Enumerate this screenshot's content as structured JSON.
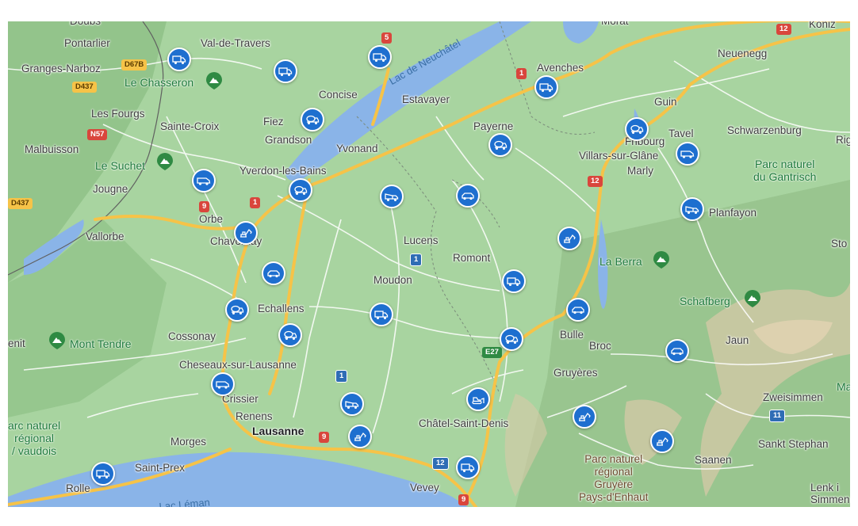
{
  "map": {
    "places": [
      {
        "id": "doubs",
        "text": "Doubs",
        "cls": "town"
      },
      {
        "id": "pontarlier",
        "text": "Pontarlier",
        "cls": "town"
      },
      {
        "id": "val-de-travers",
        "text": "Val-de-Travers",
        "cls": "town"
      },
      {
        "id": "morat",
        "text": "Morat",
        "cls": "town"
      },
      {
        "id": "koniz",
        "text": "Köniz",
        "cls": "town"
      },
      {
        "id": "granges-narboz",
        "text": "Granges-Narboz",
        "cls": "town"
      },
      {
        "id": "le-chasseron",
        "text": "Le Chasseron",
        "cls": "park"
      },
      {
        "id": "neuenegg",
        "text": "Neuenegg",
        "cls": "town"
      },
      {
        "id": "avenches",
        "text": "Avenches",
        "cls": "town"
      },
      {
        "id": "concise",
        "text": "Concise",
        "cls": "town"
      },
      {
        "id": "estavayer",
        "text": "Estavayer",
        "cls": "town"
      },
      {
        "id": "guin",
        "text": "Guin",
        "cls": "town"
      },
      {
        "id": "les-fourgs",
        "text": "Les Fourgs",
        "cls": "town"
      },
      {
        "id": "sainte-croix",
        "text": "Sainte-Croix",
        "cls": "town"
      },
      {
        "id": "fiez",
        "text": "Fiez",
        "cls": "town"
      },
      {
        "id": "payerne",
        "text": "Payerne",
        "cls": "town"
      },
      {
        "id": "schwarzenburg",
        "text": "Schwarzenburg",
        "cls": "town"
      },
      {
        "id": "tavel",
        "text": "Tavel",
        "cls": "town"
      },
      {
        "id": "fribourg",
        "text": "Fribourg",
        "cls": "town"
      },
      {
        "id": "rig",
        "text": "Rig",
        "cls": "town"
      },
      {
        "id": "grandson",
        "text": "Grandson",
        "cls": "town"
      },
      {
        "id": "malbuisson",
        "text": "Malbuisson",
        "cls": "town"
      },
      {
        "id": "yvonand",
        "text": "Yvonand",
        "cls": "town"
      },
      {
        "id": "villars-sur-glane",
        "text": "Villars-sur-Glâne",
        "cls": "town"
      },
      {
        "id": "le-suchet",
        "text": "Le Suchet",
        "cls": "park"
      },
      {
        "id": "marly",
        "text": "Marly",
        "cls": "town"
      },
      {
        "id": "parc-gantrisch",
        "text": "Parc naturel\ndu Gantrisch",
        "cls": "park"
      },
      {
        "id": "yverdon",
        "text": "Yverdon-les-Bains",
        "cls": "town"
      },
      {
        "id": "jougne",
        "text": "Jougne",
        "cls": "town"
      },
      {
        "id": "planfayon",
        "text": "Planfayon",
        "cls": "town"
      },
      {
        "id": "orbe",
        "text": "Orbe",
        "cls": "town"
      },
      {
        "id": "vallorbe",
        "text": "Vallorbe",
        "cls": "town"
      },
      {
        "id": "chavornay",
        "text": "Chavornay",
        "cls": "town"
      },
      {
        "id": "lucens",
        "text": "Lucens",
        "cls": "town"
      },
      {
        "id": "sto",
        "text": "Sto",
        "cls": "town"
      },
      {
        "id": "romont",
        "text": "Romont",
        "cls": "town"
      },
      {
        "id": "la-berra",
        "text": "La Berra",
        "cls": "park"
      },
      {
        "id": "moudon",
        "text": "Moudon",
        "cls": "town"
      },
      {
        "id": "schafberg",
        "text": "Schafberg",
        "cls": "park"
      },
      {
        "id": "echallens",
        "text": "Echallens",
        "cls": "town"
      },
      {
        "id": "mont-tendre",
        "text": "Mont Tendre",
        "cls": "park"
      },
      {
        "id": "enit",
        "text": "enit",
        "cls": "town"
      },
      {
        "id": "cossonay",
        "text": "Cossonay",
        "cls": "town"
      },
      {
        "id": "bulle",
        "text": "Bulle",
        "cls": "town"
      },
      {
        "id": "jaun",
        "text": "Jaun",
        "cls": "town"
      },
      {
        "id": "broc",
        "text": "Broc",
        "cls": "town"
      },
      {
        "id": "cheseaux",
        "text": "Cheseaux-sur-Lausanne",
        "cls": "town"
      },
      {
        "id": "gruyeres",
        "text": "Gruyères",
        "cls": "town"
      },
      {
        "id": "ma",
        "text": "Ma",
        "cls": "park"
      },
      {
        "id": "crissier",
        "text": "Crissier",
        "cls": "town"
      },
      {
        "id": "zweisimmen",
        "text": "Zweisimmen",
        "cls": "town"
      },
      {
        "id": "parc-vaudois",
        "text": "arc naturel\nrégional\n/ vaudois",
        "cls": "park"
      },
      {
        "id": "renens",
        "text": "Renens",
        "cls": "town"
      },
      {
        "id": "lausanne",
        "text": "Lausanne",
        "cls": "big"
      },
      {
        "id": "chatel",
        "text": "Châtel-Saint-Denis",
        "cls": "town"
      },
      {
        "id": "morges",
        "text": "Morges",
        "cls": "town"
      },
      {
        "id": "sankt-stephan",
        "text": "Sankt Stephan",
        "cls": "town"
      },
      {
        "id": "parc-gruyere",
        "text": "Parc naturel\nrégional\nGruyère\nPays-d'Enhaut",
        "cls": "brown"
      },
      {
        "id": "saanen",
        "text": "Saanen",
        "cls": "town"
      },
      {
        "id": "saint-prex",
        "text": "Saint-Prex",
        "cls": "town"
      },
      {
        "id": "lenk",
        "text": "Lenk i\nSimmen",
        "cls": "town"
      },
      {
        "id": "rolle",
        "text": "Rolle",
        "cls": "town"
      },
      {
        "id": "vevey",
        "text": "Vevey",
        "cls": "town"
      },
      {
        "id": "lac-neuchatel",
        "text": "Lac de Neuchâtel",
        "cls": "water"
      },
      {
        "id": "lac-leman",
        "text": "Lac Léman",
        "cls": "water"
      }
    ],
    "shields": [
      {
        "id": "5",
        "text": "5",
        "cls": "red"
      },
      {
        "id": "12a",
        "text": "12",
        "cls": "red"
      },
      {
        "id": "d67b",
        "text": "D67B",
        "cls": "yellow"
      },
      {
        "id": "d437a",
        "text": "D437",
        "cls": "yellow"
      },
      {
        "id": "1a",
        "text": "1",
        "cls": "red"
      },
      {
        "id": "n57",
        "text": "N57",
        "cls": "red"
      },
      {
        "id": "12b",
        "text": "12",
        "cls": "red"
      },
      {
        "id": "d437b",
        "text": "D437",
        "cls": "yellow"
      },
      {
        "id": "9a",
        "text": "9",
        "cls": "red"
      },
      {
        "id": "1b",
        "text": "1",
        "cls": "red"
      },
      {
        "id": "1c",
        "text": "1",
        "cls": "blue"
      },
      {
        "id": "e27",
        "text": "E27",
        "cls": "green"
      },
      {
        "id": "1d",
        "text": "1",
        "cls": "blue"
      },
      {
        "id": "11",
        "text": "11",
        "cls": "blue"
      },
      {
        "id": "9b",
        "text": "9",
        "cls": "red"
      },
      {
        "id": "12c",
        "text": "12",
        "cls": "blue"
      },
      {
        "id": "9c",
        "text": "9",
        "cls": "red"
      }
    ],
    "markers": [
      {
        "icon": "delivery-van-icon"
      },
      {
        "icon": "delivery-van-icon"
      },
      {
        "icon": "delivery-van-icon"
      },
      {
        "icon": "cement-mixer-icon"
      },
      {
        "icon": "van-icon"
      },
      {
        "icon": "cement-mixer-icon"
      },
      {
        "icon": "dump-truck-icon"
      },
      {
        "icon": "excavator-icon"
      },
      {
        "icon": "car-icon"
      },
      {
        "icon": "excavator-icon"
      },
      {
        "icon": "car-icon"
      },
      {
        "icon": "cement-mixer-icon"
      },
      {
        "icon": "delivery-van-icon"
      },
      {
        "icon": "dump-truck-icon"
      },
      {
        "icon": "delivery-van-icon"
      },
      {
        "icon": "excavator-icon"
      },
      {
        "icon": "van-icon"
      },
      {
        "icon": "van-icon"
      },
      {
        "icon": "cement-mixer-icon"
      },
      {
        "icon": "van-icon"
      },
      {
        "icon": "cement-mixer-icon"
      },
      {
        "icon": "cement-mixer-icon"
      },
      {
        "icon": "delivery-van-icon"
      },
      {
        "icon": "cement-mixer-icon"
      },
      {
        "icon": "car-icon"
      },
      {
        "icon": "bulldozer-icon"
      },
      {
        "icon": "excavator-icon"
      },
      {
        "icon": "car-icon"
      },
      {
        "icon": "excavator-icon"
      },
      {
        "icon": "dump-truck-icon"
      },
      {
        "icon": "delivery-van-icon"
      },
      {
        "icon": "delivery-van-icon"
      }
    ],
    "colors": {
      "land": "#a8d4a0",
      "lake": "#8ab4e8",
      "highway": "#f6c348",
      "road": "#ffffff",
      "marker": "#1e6fcf",
      "mountain": "#d9c9a8"
    }
  }
}
